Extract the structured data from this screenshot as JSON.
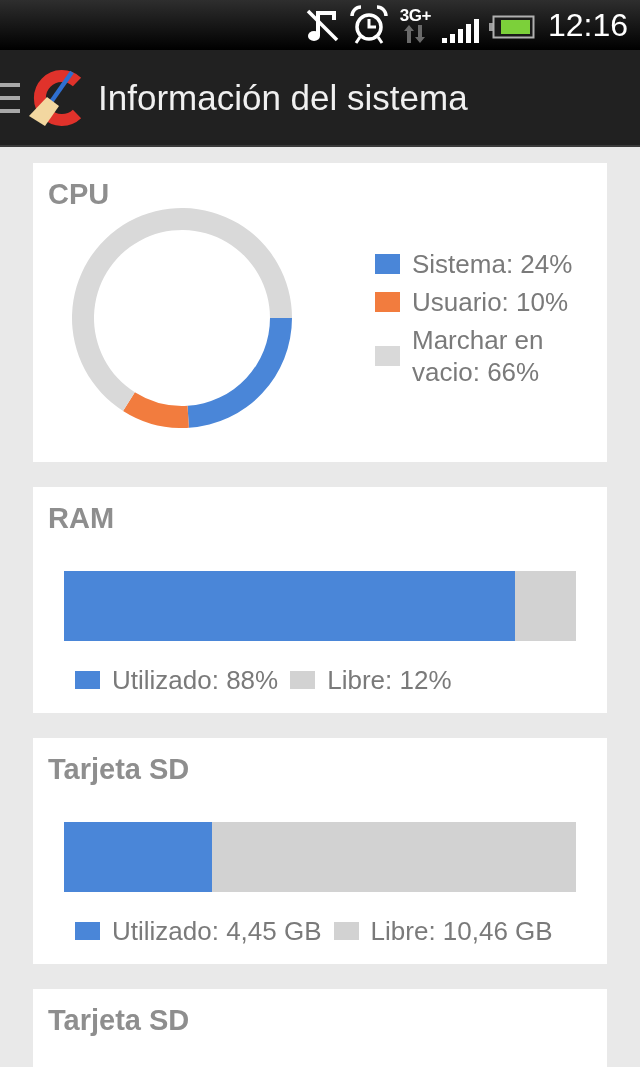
{
  "status_bar": {
    "network_type": "3G+",
    "time": "12:16"
  },
  "app_bar": {
    "title": "Información del sistema"
  },
  "cpu_card": {
    "title": "CPU",
    "chart_data": {
      "type": "donut",
      "values": [
        24,
        10,
        66
      ]
    },
    "legend": [
      {
        "label": "Sistema: 24%",
        "color": "#4a86d8"
      },
      {
        "label": "Usuario: 10%",
        "color": "#f27c3e"
      },
      {
        "label": "Marchar en vacio: 66%",
        "color": "#d9d9d9"
      }
    ]
  },
  "ram_card": {
    "title": "RAM",
    "usage_bar": {
      "level": 0.88
    },
    "legend": [
      {
        "label": "Utilizado: 88%",
        "color": "#4a86d8"
      },
      {
        "label": "Libre: 12%",
        "color": "#d2d2d2"
      }
    ]
  },
  "sd_card": {
    "title": "Tarjeta SD",
    "usage_bar": {
      "level": 0.29
    },
    "legend": [
      {
        "label": "Utilizado: 4,45 GB",
        "color": "#4a86d8"
      },
      {
        "label": "Libre: 10,46 GB",
        "color": "#d2d2d2"
      }
    ]
  },
  "next_card": {
    "title": "Tarjeta SD"
  }
}
